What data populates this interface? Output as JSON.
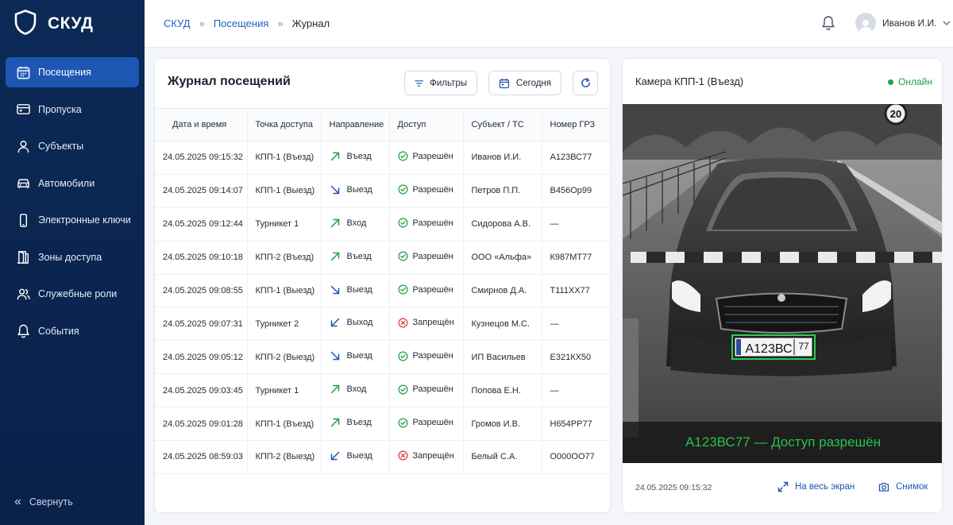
{
  "app": {
    "brand": "СКУД"
  },
  "sidebar": {
    "items": [
      {
        "label": "Посещения",
        "icon": "calendar-icon",
        "active": true
      },
      {
        "label": "Пропуска",
        "icon": "id-card-icon",
        "active": false
      },
      {
        "label": "Субъекты",
        "icon": "user-icon",
        "active": false
      },
      {
        "label": "Автомобили",
        "icon": "car-icon",
        "active": false
      },
      {
        "label": "Электронные ключи",
        "icon": "phone-key-icon",
        "active": false
      },
      {
        "label": "Зоны доступа",
        "icon": "door-icon",
        "active": false
      },
      {
        "label": "Служебные роли",
        "icon": "users-icon",
        "active": false
      },
      {
        "label": "События",
        "icon": "bell-icon",
        "active": false
      }
    ],
    "collapse_label": "Свернуть"
  },
  "header": {
    "breadcrumb": [
      "СКУД",
      "Посещения",
      "Журнал"
    ],
    "user_name": "Иванов И.И."
  },
  "journal": {
    "title": "Журнал посещений",
    "filters_label": "Фильтры",
    "today_label": "Сегодня",
    "columns": [
      "Дата и время",
      "Точка доступа",
      "Направление",
      "Доступ",
      "Субъект / ТС",
      "Номер ГРЗ"
    ],
    "rows": [
      {
        "datetime": "24.05.2025 09:15:32",
        "point": "КПП-1 (Въезд)",
        "direction": "Въезд",
        "dir_kind": "in",
        "access": "Разрешён",
        "granted": true,
        "subject": "Иванов И.И.",
        "plate": "А123ВС77"
      },
      {
        "datetime": "24.05.2025 09:14:07",
        "point": "КПП-1 (Выезд)",
        "direction": "Выезд",
        "dir_kind": "out",
        "access": "Разрешён",
        "granted": true,
        "subject": "Петров П.П.",
        "plate": "В456Ор99"
      },
      {
        "datetime": "24.05.2025 09:12:44",
        "point": "Турникет 1",
        "direction": "Вход",
        "dir_kind": "in",
        "access": "Разрешён",
        "granted": true,
        "subject": "Сидорова А.В.",
        "plate": "—"
      },
      {
        "datetime": "24.05.2025 09:10:18",
        "point": "КПП-2 (Въезд)",
        "direction": "Въезд",
        "dir_kind": "in",
        "access": "Разрешён",
        "granted": true,
        "subject": "ООО «Альфа»",
        "plate": "К987МТ77"
      },
      {
        "datetime": "24.05.2025 09:08:55",
        "point": "КПП-1 (Выезд)",
        "direction": "Выезд",
        "dir_kind": "out",
        "access": "Разрешён",
        "granted": true,
        "subject": "Смирнов Д.А.",
        "plate": "Т111ХХ77"
      },
      {
        "datetime": "24.05.2025 09:07:31",
        "point": "Турникет 2",
        "direction": "Выход",
        "dir_kind": "exit",
        "access": "Запрещён",
        "granted": false,
        "subject": "Кузнецов М.С.",
        "plate": "—"
      },
      {
        "datetime": "24.05.2025 09:05:12",
        "point": "КПП-2 (Выезд)",
        "direction": "Выезд",
        "dir_kind": "out",
        "access": "Разрешён",
        "granted": true,
        "subject": "ИП Васильев",
        "plate": "Е321КХ50"
      },
      {
        "datetime": "24.05.2025 09:03:45",
        "point": "Турникет 1",
        "direction": "Вход",
        "dir_kind": "in",
        "access": "Разрешён",
        "granted": true,
        "subject": "Попова Е.Н.",
        "plate": "—"
      },
      {
        "datetime": "24.05.2025 09:01:28",
        "point": "КПП-1 (Въезд)",
        "direction": "Въезд",
        "dir_kind": "in",
        "access": "Разрешён",
        "granted": true,
        "subject": "Громов И.В.",
        "plate": "Н654РР77"
      },
      {
        "datetime": "24.05.2025 08:59:03",
        "point": "КПП-2 (Выезд)",
        "direction": "Выезд",
        "dir_kind": "exit",
        "access": "Запрещён",
        "granted": false,
        "subject": "Белый С.А.",
        "plate": "О000ОО77"
      }
    ]
  },
  "camera": {
    "title": "Камера КПП-1 (Въезд)",
    "status": "Онлайн",
    "speed_sign": "20",
    "plate_main": "А123ВС",
    "plate_region": "77",
    "caption": "А123ВС77 — Доступ разрешён",
    "timestamp": "24.05.2025 09:15:32",
    "fullscreen_label": "На весь экран",
    "snapshot_label": "Снимок"
  },
  "colors": {
    "sidebar": "#0b2a57",
    "active": "#1e56b3",
    "link": "#1e63c7",
    "granted": "#1f9d44",
    "denied": "#d93a3a",
    "caption": "#29c04b"
  }
}
